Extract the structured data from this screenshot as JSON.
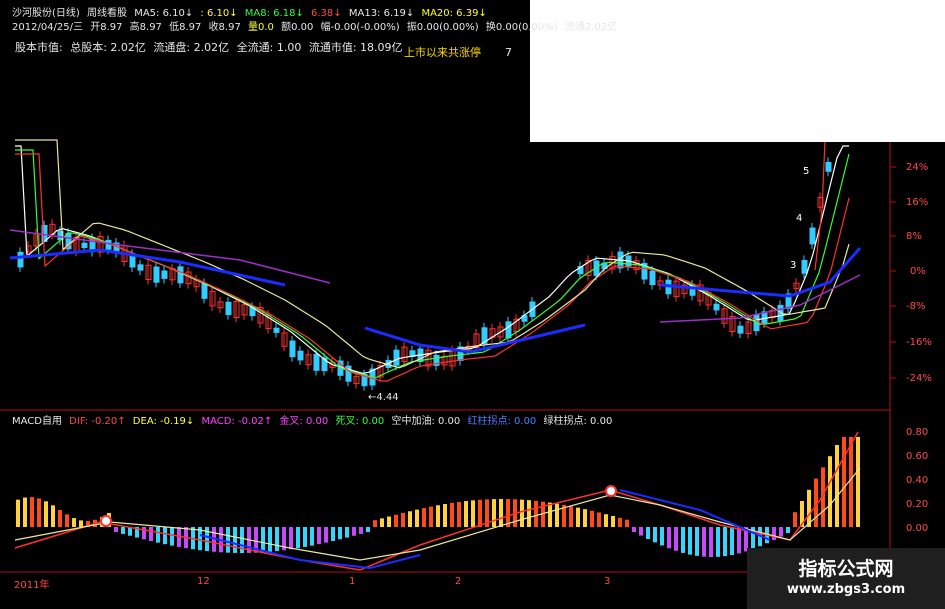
{
  "header": {
    "title": "沙河股份(日线)",
    "mode": "周线看股",
    "ma5": "MA5: 6.10↓",
    "ma5b": ": 6.10↓",
    "ma8": "MA8: 6.18↓",
    "ma8b": "6.38↓",
    "ma13": "MA13: 6.19↓",
    "ma20": "MA20: 6.39↓"
  },
  "price": {
    "date": "2012/04/25/三",
    "open": "开8.97",
    "high": "高8.97",
    "low": "低8.97",
    "close": "收8.97",
    "vol": "量0.0",
    "amount": "额0.00",
    "chg": "幅-0.00(-0.00%)",
    "swing": "振0.00(0.00%)",
    "turnover": "换0.00(0.00%)",
    "float": "流通2.02亿"
  },
  "cap": {
    "label": "股本市值:",
    "total_shares": "总股本: 2.02亿",
    "float_shares": "流通盘: 2.02亿",
    "full_float": "全流通: 1.00",
    "float_mkt": "流通市值: 18.09亿"
  },
  "limit": {
    "label": "上市以来共涨停",
    "count": "7"
  },
  "macd": {
    "name": "MACD自用",
    "dif": "DIF: -0.20↑",
    "dea": "DEA: -0.19↓",
    "macd": "MACD: -0.02↑",
    "golden": "金叉: 0.00",
    "death": "死叉: 0.00",
    "air": "空中加油: 0.00",
    "red_turn": "红柱拐点: 0.00",
    "green_turn": "绿柱拐点: 0.00"
  },
  "price_axis": [
    "24%",
    "16%",
    "8%",
    "0%",
    "-8%",
    "-16%",
    "-24%"
  ],
  "macd_axis": [
    "0.80",
    "0.60",
    "0.40",
    "0.20",
    "0.00"
  ],
  "time_axis": [
    "2011年",
    "12",
    "1",
    "2",
    "3"
  ],
  "annotations": {
    "low": "←4.44",
    "w3": "3",
    "w4": "4",
    "w5": "5"
  },
  "watermark": {
    "title": "指标公式网",
    "url": "www.zbgs3.com"
  },
  "colors": {
    "up": "#ff3030",
    "down": "#33ccff",
    "dif": "#ff3030",
    "dea": "#e8e8a0",
    "ma_blue": "#1a2cff",
    "ma_purple": "#9a30c8"
  }
}
